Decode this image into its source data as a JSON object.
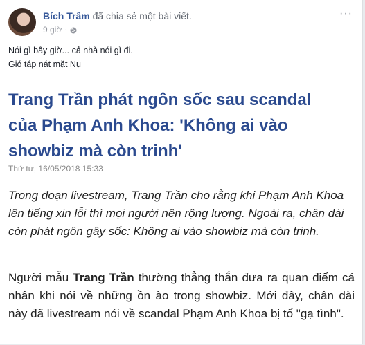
{
  "post": {
    "author": "Bích Trâm",
    "action": "đã chia sẻ một bài viết.",
    "time": "9 giờ",
    "separator": "·",
    "more": "···",
    "text_line1": "Nói gì bây giờ... cả nhà nói gì đi.",
    "text_line2": "Gió táp nát mặt Nụ"
  },
  "article": {
    "title": "Trang Trần phát ngôn sốc sau scandal của Phạm Anh Khoa: 'Không ai vào showbiz mà còn trinh'",
    "date": "Thứ tư, 16/05/2018 15:33",
    "lead": "Trong đoạn livestream, Trang Trần cho rằng khi Phạm Anh Khoa lên tiếng xin lỗi thì mọi người nên rộng lượng. Ngoài ra, chân dài còn phát ngôn gây sốc: Không ai vào showbiz mà còn trinh.",
    "body_before": "Người mẫu ",
    "body_bold": "Trang Trần",
    "body_after": " thường thẳng thắn đưa ra quan điểm cá nhân khi nói về những ồn ào trong showbiz. Mới đây, chân dài này đã livestream nói về scandal Phạm Anh Khoa bị tố \"gạ tình\"."
  }
}
